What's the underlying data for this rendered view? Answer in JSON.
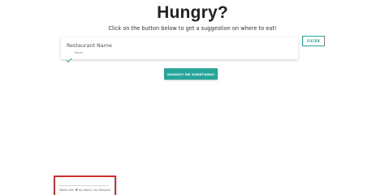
{
  "header": {
    "title": "Hungry?",
    "subtitle": "Click on the button below to get a suggestion on where to eat!"
  },
  "restaurant_card": {
    "name_label": "Restaurant Name",
    "rated_label": "Rated",
    "check_icon": "check-icon"
  },
  "filter": {
    "label": "FILTER"
  },
  "suggest": {
    "label": "SUGGEST ME SOMETHING!"
  },
  "footer": {
    "text": "Made with ♥ by Adam, for Maryam"
  },
  "colors": {
    "accent": "#26a69a",
    "highlight": "#d32f2f",
    "title": "#222222"
  }
}
